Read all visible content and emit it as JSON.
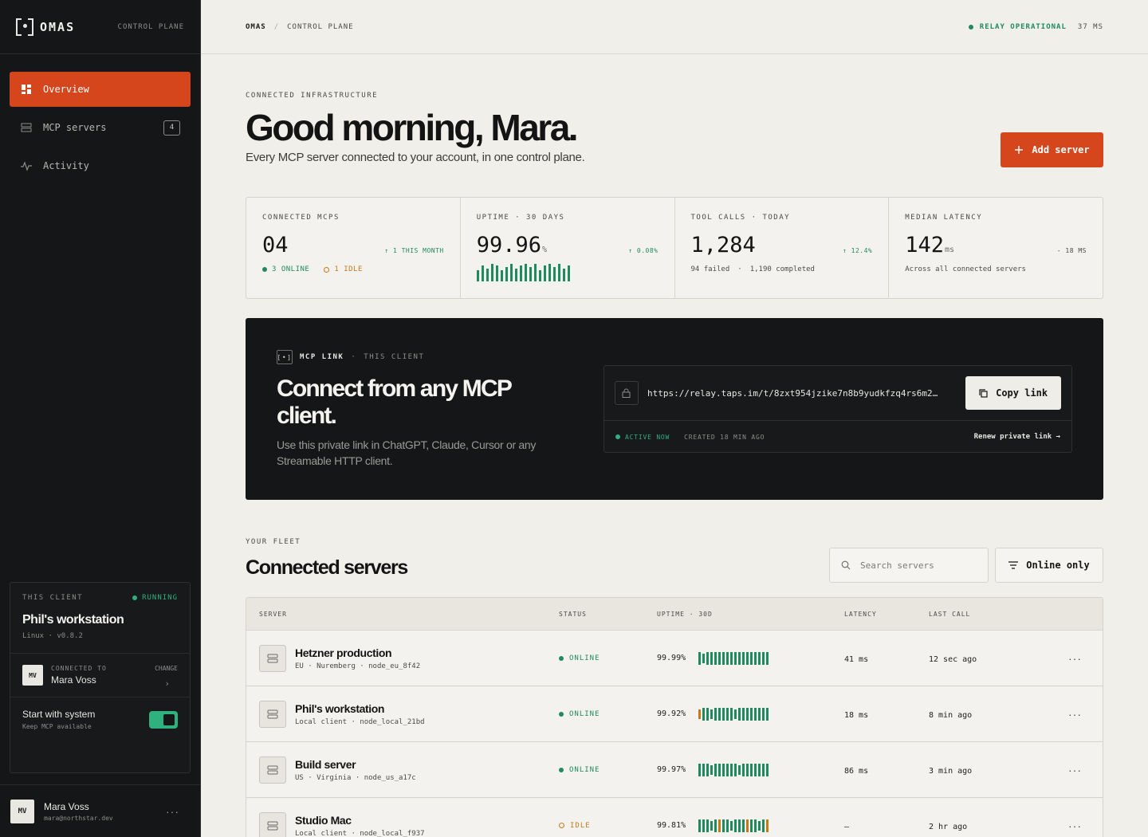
{
  "app": {
    "name": "OMAS",
    "tag": "CONTROL PLANE"
  },
  "nav": [
    {
      "label": "Overview",
      "icon": "dashboard-icon",
      "active": true
    },
    {
      "label": "MCP servers",
      "icon": "server-icon",
      "badge": "4"
    },
    {
      "label": "Activity",
      "icon": "activity-icon"
    }
  ],
  "client": {
    "label": "THIS CLIENT",
    "status": "RUNNING",
    "name": "Phil's workstation",
    "sub": "Linux · v0.8.2",
    "connected_label": "CONNECTED TO",
    "connected_name": "Mara Voss",
    "avatar": "MV",
    "change": "CHANGE",
    "start_title": "Start with system",
    "start_sub": "Keep MCP available"
  },
  "user": {
    "name": "Mara Voss",
    "email": "mara@northstar.dev",
    "avatar": "MV"
  },
  "topbar": {
    "crumb1": "OMAS",
    "crumb2": "CONTROL PLANE",
    "relay": "RELAY OPERATIONAL",
    "latency": "37 MS"
  },
  "header": {
    "eyebrow": "CONNECTED INFRASTRUCTURE",
    "title": "Good morning, Mara.",
    "subtitle": "Every MCP server connected to your account, in one control plane.",
    "add_button": "Add server"
  },
  "stats": {
    "connected": {
      "label": "CONNECTED MCPS",
      "value": "04",
      "delta": "↑ 1 THIS MONTH",
      "online": "3 ONLINE",
      "idle": "1 IDLE"
    },
    "uptime": {
      "label": "UPTIME · 30 DAYS",
      "value": "99.96",
      "unit": "%",
      "delta": "↑ 0.08%"
    },
    "tools": {
      "label": "TOOL CALLS · TODAY",
      "value": "1,284",
      "delta": "↑ 12.4%",
      "failed": "94 failed",
      "completed": "1,190 completed"
    },
    "latency": {
      "label": "MEDIAN LATENCY",
      "value": "142",
      "unit": "ms",
      "delta": "- 18 MS",
      "foot": "Across all connected servers"
    }
  },
  "link": {
    "eyebrow_strong": "MCP LINK",
    "eyebrow": "THIS CLIENT",
    "title": "Connect from any MCP client.",
    "description": "Use this private link in ChatGPT, Claude, Cursor or any Streamable HTTP client.",
    "url": "https://relay.taps.im/t/8zxt954jzike7n8b9yudkfzq4rs6m2…",
    "copy": "Copy link",
    "active": "ACTIVE NOW",
    "created": "CREATED 18 MIN AGO",
    "renew": "Renew private link →"
  },
  "fleet": {
    "eyebrow": "YOUR FLEET",
    "title": "Connected servers",
    "search_placeholder": "Search servers",
    "filter": "Online only",
    "columns": {
      "server": "SERVER",
      "status": "STATUS",
      "uptime": "UPTIME · 30D",
      "latency": "LATENCY",
      "last": "LAST CALL"
    },
    "rows": [
      {
        "name": "Hetzner production",
        "meta": "EU · Nuremberg · node_eu_8f42",
        "status": "ONLINE",
        "uptime": "99.99%",
        "latency": "41 ms",
        "last": "12 sec ago"
      },
      {
        "name": "Phil's workstation",
        "meta": "Local client · node_local_21bd",
        "status": "ONLINE",
        "uptime": "99.92%",
        "latency": "18 ms",
        "last": "8 min ago"
      },
      {
        "name": "Build server",
        "meta": "US · Virginia · node_us_a17c",
        "status": "ONLINE",
        "uptime": "99.97%",
        "latency": "86 ms",
        "last": "3 min ago"
      },
      {
        "name": "Studio Mac",
        "meta": "Local client · node_local_f937",
        "status": "IDLE",
        "uptime": "99.81%",
        "latency": "—",
        "last": "2 hr ago"
      }
    ]
  },
  "colors": {
    "accent": "#d6461d",
    "online": "#1f8a5e",
    "idle": "#c7791a",
    "dark": "#141617"
  }
}
